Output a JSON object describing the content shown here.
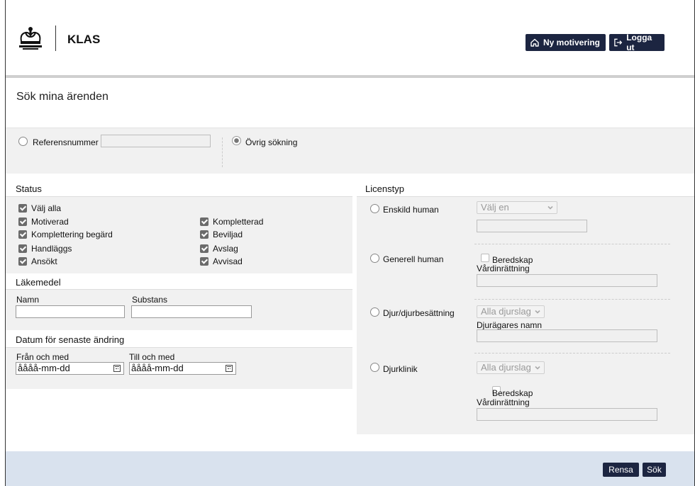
{
  "header": {
    "app_name": "KLAS",
    "new_motivation_label": "Ny motivering",
    "logout_label": "Logga ut"
  },
  "page": {
    "title": "Sök mina ärenden"
  },
  "search_type": {
    "reference_label": "Referensnummer",
    "reference_value": "",
    "other_label": "Övrig sökning",
    "selected": "other"
  },
  "status": {
    "title": "Status",
    "select_all": "Välj alla",
    "left_items": [
      "Motiverad",
      "Komplettering begärd",
      "Handläggs",
      "Ansökt"
    ],
    "right_items": [
      "Kompletterad",
      "Beviljad",
      "Avslag",
      "Avvisad"
    ]
  },
  "medicine": {
    "title": "Läkemedel",
    "name_label": "Namn",
    "name_value": "",
    "substance_label": "Substans",
    "substance_value": ""
  },
  "date": {
    "title": "Datum för senaste ändring",
    "from_label": "Från och med",
    "from_placeholder": "åååå-mm-dd",
    "to_label": "Till och med",
    "to_placeholder": "åååå-mm-dd"
  },
  "license": {
    "title": "Licenstyp",
    "individual_label": "Enskild human",
    "individual_select": "Välj en",
    "general_label": "Generell human",
    "preparedness_label": "Beredskap",
    "care_unit_label": "Vårdinrättning",
    "animal_label": "Djur/djurbesättning",
    "animal_species_select": "Alla djurslag",
    "owner_label": "Djurägares namn",
    "clinic_label": "Djurklinik",
    "clinic_species_select": "Alla djurslag",
    "clinic_preparedness_label": "Beredskap",
    "clinic_care_unit_label": "Vårdinrättning"
  },
  "footer": {
    "clear_label": "Rensa",
    "search_label": "Sök"
  },
  "colors": {
    "button_bg": "#1c2541",
    "footer_bg": "#d9e2ee",
    "panel_bg": "#f1f1f1"
  }
}
